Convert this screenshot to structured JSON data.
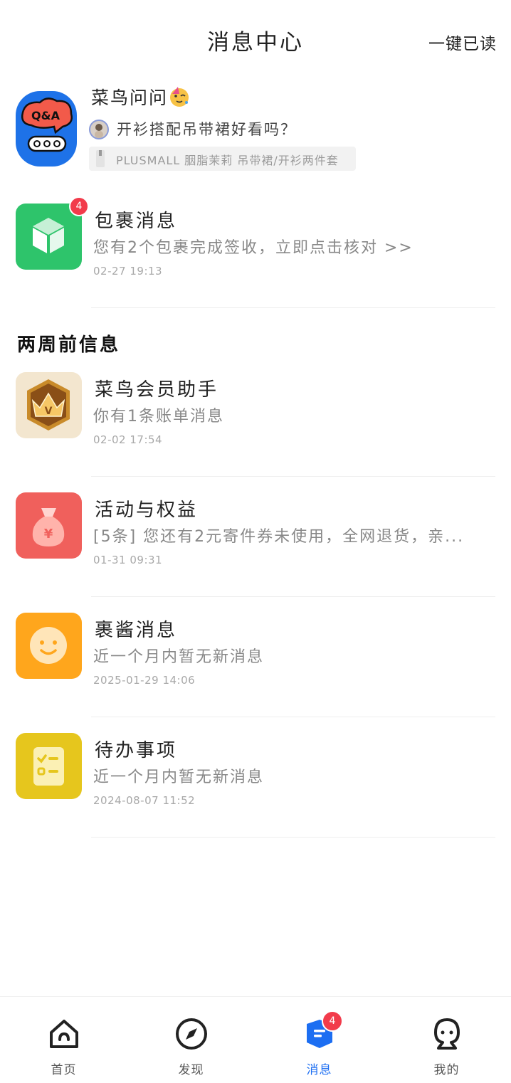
{
  "header": {
    "title": "消息中心",
    "action": "一键已读"
  },
  "qa": {
    "title": "菜鸟问问",
    "subtitle": "开衫搭配吊带裙好看吗？",
    "chip_text": "PLUSMALL 胭脂茉莉 吊带裙/开衫两件套",
    "avatar_text": "Q&A"
  },
  "messages": [
    {
      "title": "包裹消息",
      "desc": "您有2个包裹完成签收，立即点击核对 >>",
      "time": "02-27 19:13",
      "badge": "4",
      "color": "#2ec46b",
      "icon": "package-icon"
    }
  ],
  "section": {
    "title": "两周前信息"
  },
  "older": [
    {
      "title": "菜鸟会员助手",
      "desc": "你有1条账单消息",
      "time": "02-02 17:54",
      "color": "#f1e2c6",
      "icon": "crown-icon",
      "icon_letter": "V"
    },
    {
      "title": "活动与权益",
      "desc": "[5条] 您还有2元寄件券未使用，全网退货，亲...",
      "time": "01-31 09:31",
      "color": "#f0605c",
      "icon": "money-bag-icon",
      "icon_letter": "¥"
    },
    {
      "title": "裹酱消息",
      "desc": "近一个月内暂无新消息",
      "time": "2025-01-29 14:06",
      "color": "#ffa61c",
      "icon": "smiley-icon"
    },
    {
      "title": "待办事项",
      "desc": "近一个月内暂无新消息",
      "time": "2024-08-07 11:52",
      "color": "#e6c61d",
      "icon": "checklist-icon"
    }
  ],
  "tabbar": {
    "tabs": [
      {
        "label": "首页",
        "icon": "home-icon"
      },
      {
        "label": "发现",
        "icon": "compass-icon"
      },
      {
        "label": "消息",
        "icon": "message-icon",
        "active": true
      },
      {
        "label": "我的",
        "icon": "profile-icon"
      }
    ],
    "message_badge": "4",
    "active_color": "#1c6ef2"
  }
}
